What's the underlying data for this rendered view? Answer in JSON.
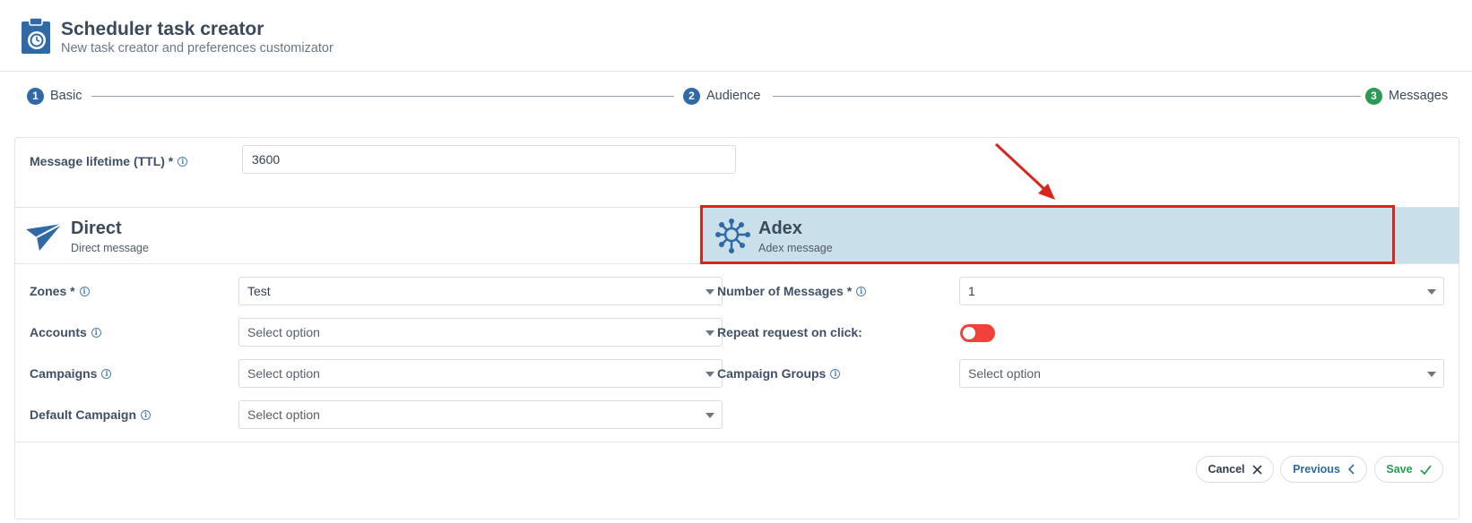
{
  "header": {
    "title": "Scheduler task creator",
    "subtitle": "New task creator and preferences customizator",
    "icon": "clipboard-timer-icon"
  },
  "stepper": {
    "steps": [
      {
        "number": "1",
        "label": "Basic",
        "color": "#2f6aa6"
      },
      {
        "number": "2",
        "label": "Audience",
        "color": "#2f6aa6"
      },
      {
        "number": "3",
        "label": "Messages",
        "color": "#2a9a54"
      }
    ]
  },
  "form": {
    "ttl": {
      "label": "Message lifetime (TTL) *",
      "value": "3600"
    },
    "tabs": [
      {
        "title": "Direct",
        "subtitle": "Direct message",
        "icon": "paper-plane-icon",
        "selected": false
      },
      {
        "title": "Adex",
        "subtitle": "Adex message",
        "icon": "network-search-icon",
        "selected": true
      }
    ],
    "left": [
      {
        "label": "Zones *",
        "value": "Test",
        "placeholder": ""
      },
      {
        "label": "Accounts",
        "value": "",
        "placeholder": "Select option"
      },
      {
        "label": "Campaigns",
        "value": "",
        "placeholder": "Select option"
      },
      {
        "label": "Default Campaign",
        "value": "",
        "placeholder": "Select option"
      }
    ],
    "right": {
      "num_messages": {
        "label": "Number of Messages *",
        "value": "1"
      },
      "repeat": {
        "label": "Repeat request on click:",
        "on": false
      },
      "campaign_groups": {
        "label": "Campaign Groups",
        "placeholder": "Select option"
      }
    }
  },
  "footer": {
    "cancel_label": "Cancel",
    "previous_label": "Previous",
    "save_label": "Save"
  },
  "colors": {
    "accent": "#2f6aa6",
    "success": "#2a9a54",
    "highlight": "#d9251d",
    "selected_tab": "#c9dfea",
    "toggle": "#f0413a"
  }
}
